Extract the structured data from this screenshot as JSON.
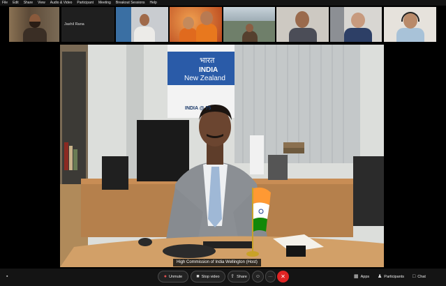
{
  "menu": [
    "File",
    "Edit",
    "Share",
    "View",
    "Audio & Video",
    "Participant",
    "Meeting",
    "Breakout Sessions",
    "Help"
  ],
  "participants": {
    "tile2_name": "Jashil Rana"
  },
  "host_label": "High Commission of India Wellington (Host)",
  "banner": {
    "hindi": "भारत",
    "country": "INDIA",
    "subtitle": "New Zealand",
    "logo_text": "INDIA @ 75"
  },
  "controls": {
    "unmute": "Unmute",
    "stop_video": "Stop video",
    "share": "Share",
    "more": "···",
    "end": "✕",
    "apps": "Apps",
    "participants": "Participants",
    "chat": "Chat"
  },
  "colors": {
    "end": "#e02424",
    "bar": "#141414",
    "flag_saffron": "#ff9933",
    "flag_green": "#138808"
  }
}
